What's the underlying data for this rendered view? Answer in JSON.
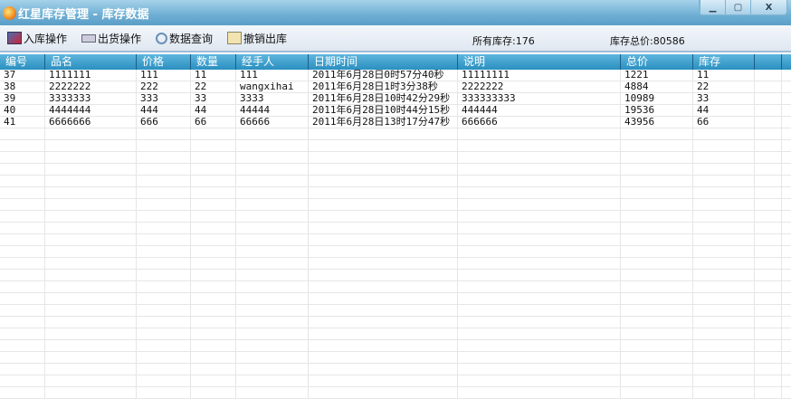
{
  "window": {
    "title": "红星库存管理 - 库存数据",
    "minimize": "▁",
    "maximize": "▢",
    "close": "X"
  },
  "toolbar": {
    "stock_in": "入库操作",
    "ship_out": "出货操作",
    "query": "数据查询",
    "cancel_out": "撤销出库",
    "total_stock_label": "所有库存:176",
    "total_value_label": "库存总价:80586"
  },
  "table": {
    "columns": [
      "编号",
      "品名",
      "价格",
      "数量",
      "经手人",
      "日期时间",
      "说明",
      "总价",
      "库存"
    ],
    "rows": [
      [
        "37",
        "1111111",
        "111",
        "11",
        "111",
        "2011年6月28日0时57分40秒",
        "11111111",
        "1221",
        "11"
      ],
      [
        "38",
        "2222222",
        "222",
        "22",
        "wangxihai",
        "2011年6月28日1时3分38秒",
        "2222222",
        "4884",
        "22"
      ],
      [
        "39",
        "3333333",
        "333",
        "33",
        "3333",
        "2011年6月28日10时42分29秒",
        "333333333",
        "10989",
        "33"
      ],
      [
        "40",
        "4444444",
        "444",
        "44",
        "44444",
        "2011年6月28日10时44分15秒",
        "444444",
        "19536",
        "44"
      ],
      [
        "41",
        "6666666",
        "666",
        "66",
        "66666",
        "2011年6月28日13时17分47秒",
        "666666",
        "43956",
        "66"
      ]
    ]
  }
}
